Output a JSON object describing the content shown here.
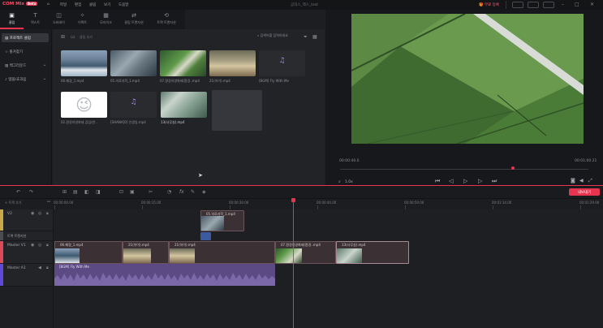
{
  "app": {
    "logo": "COM Mix",
    "version": "Beta",
    "window_title": "곰믹스_맥스_test"
  },
  "menu": [
    "파일",
    "편집",
    "클립",
    "보기",
    "도움말"
  ],
  "topbar": {
    "upgrade": "무료 등록",
    "accent": "#e8344f"
  },
  "tabs": [
    {
      "label": "클립",
      "icon": "clip-icon"
    },
    {
      "label": "텍스트",
      "icon": "text-icon"
    },
    {
      "label": "오버레이",
      "icon": "overlay-icon"
    },
    {
      "label": "이펙트",
      "icon": "effect-icon"
    },
    {
      "label": "모자이크",
      "icon": "mosaic-icon"
    },
    {
      "label": "클립 트랜지션",
      "icon": "transition-icon"
    },
    {
      "label": "트랙 트랜지션",
      "icon": "track-transition-icon"
    }
  ],
  "sidebar": [
    {
      "label": "프로젝트 클립"
    },
    {
      "label": "즐겨찾기"
    },
    {
      "label": "백그라운드"
    },
    {
      "label": "템플/효과음"
    }
  ],
  "media": {
    "add_label": "클립 추가",
    "search_placeholder": "검색어를 입력하세요",
    "items": [
      {
        "name": "06.폐경_1.mp4",
        "kind": "video"
      },
      {
        "name": "05.의료과학_1.mp4",
        "kind": "video"
      },
      {
        "name": "07.환경의영화제(환경..mp4",
        "kind": "video"
      },
      {
        "name": "21(하이).mp4",
        "kind": "video"
      },
      {
        "name": "[BGM] Fly With Me",
        "kind": "audio"
      },
      {
        "name": "02.환경의영화제 감입(한..",
        "kind": "image"
      },
      {
        "name": "[SHANA]0] 인생일.mp4",
        "kind": "audio"
      },
      {
        "name": "13(사무실).mp4",
        "kind": "video"
      }
    ]
  },
  "preview": {
    "time_current": "00:00:40.0",
    "time_total": "00:01:00.21",
    "zoom": "1.0x"
  },
  "timeline": {
    "add_label": "트랙 추가",
    "export": "내보내기",
    "ruler": [
      "00:00:00.00",
      "00:00:15.00",
      "00:00:30.00",
      "00:00:44.00",
      "00:00:59.00",
      "00:01:14.00",
      "00:01:29.00"
    ],
    "tracks": [
      {
        "name": "V2",
        "color": "#c8a94a"
      },
      {
        "name": "트랙 트랜지션",
        "color": "#4a4c52"
      },
      {
        "name": "Master V1",
        "color": "#d94a5a"
      },
      {
        "name": "Master A1",
        "color": "#5d4ad9"
      }
    ],
    "clips_v2": [
      {
        "label": "05.의료과학_1.mp4"
      }
    ],
    "clips_v1": [
      {
        "label": "06.폐경_1.mp4"
      },
      {
        "label": "21(하이).mp4"
      },
      {
        "label": "21(하이).mp4"
      },
      {
        "label": "07.환경의영화제(환경..mp4"
      },
      {
        "label": "13(사무실).mp4"
      }
    ],
    "clip_audio": {
      "label": "[BGM] Fly With Me"
    }
  }
}
